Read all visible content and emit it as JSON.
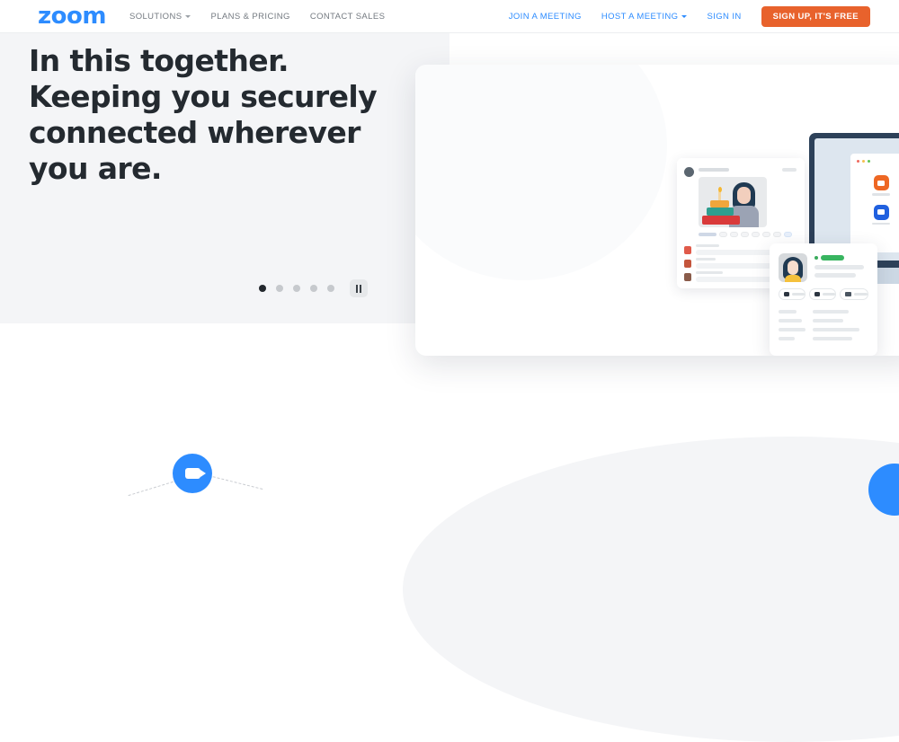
{
  "navbar": {
    "logo": "zoom",
    "left_links": [
      {
        "label": "SOLUTIONS",
        "has_caret": true
      },
      {
        "label": "PLANS & PRICING",
        "has_caret": false
      },
      {
        "label": "CONTACT SALES",
        "has_caret": false
      }
    ],
    "right_links": [
      {
        "label": "JOIN A MEETING",
        "has_caret": false
      },
      {
        "label": "HOST A MEETING",
        "has_caret": true
      },
      {
        "label": "SIGN IN",
        "has_caret": false
      }
    ],
    "signup_button": "SIGN UP, IT'S FREE"
  },
  "hero": {
    "title": "In this together. Keeping you securely connected wherever you are.",
    "background_color": "#f4f5f7",
    "carousel": {
      "total_dots": 5,
      "active_index": 0,
      "pause_label": "Pause"
    }
  },
  "colors": {
    "brand_blue": "#2D8CFF",
    "accent_orange": "#E8622C",
    "text_dark": "#242a30",
    "text_muted": "#747a81",
    "panel_gray": "#f4f5f7",
    "status_green": "#38b560",
    "monitor_navy": "#2d4159"
  },
  "illustration": {
    "chat_panel": {
      "name": "chat-message-panel"
    },
    "monitor": {
      "name": "desktop-monitor"
    },
    "contact_card": {
      "name": "contact-profile-card"
    },
    "app_icons": [
      {
        "name": "meetings-icon",
        "color": "#EE6723"
      },
      {
        "name": "chat-icon",
        "color": "#2D8CFF"
      },
      {
        "name": "phone-icon",
        "color": "#2D8CFF"
      },
      {
        "name": "rooms-icon",
        "color": "#2060DF"
      },
      {
        "name": "webinar-icon",
        "color": "#2D8CFF"
      },
      {
        "name": "contacts-icon",
        "color": "#2D8CFF"
      }
    ]
  },
  "bottom": {
    "video_icon": "video-camera-icon",
    "corner_circle": "blue-circle-accent"
  }
}
